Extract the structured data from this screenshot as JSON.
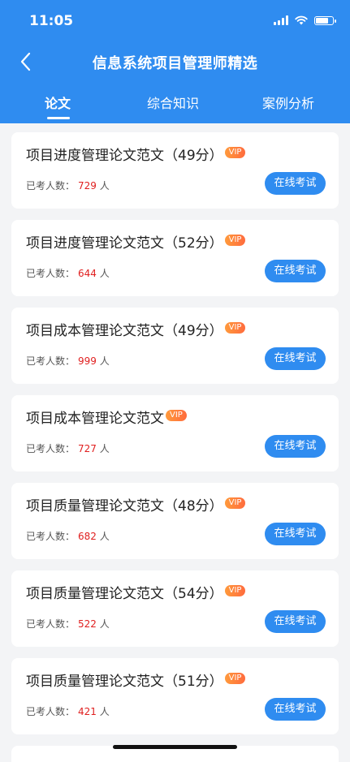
{
  "status_bar": {
    "time": "11:05"
  },
  "header": {
    "title": "信息系统项目管理师精选",
    "tabs": [
      {
        "label": "论文",
        "active": true
      },
      {
        "label": "综合知识",
        "active": false
      },
      {
        "label": "案例分析",
        "active": false
      }
    ]
  },
  "colors": {
    "accent": "#2f8cf0",
    "count_red": "#e02020",
    "vip_orange": "#ff7a3d"
  },
  "list": {
    "count_label": "已考人数：",
    "count_suffix": "人",
    "button_label": "在线考试",
    "vip_label": "VIP",
    "items": [
      {
        "title": "项目进度管理论文范文（49分）",
        "count": "729"
      },
      {
        "title": "项目进度管理论文范文（52分）",
        "count": "644"
      },
      {
        "title": "项目成本管理论文范文（49分）",
        "count": "999"
      },
      {
        "title": "项目成本管理论文范文",
        "count": "727"
      },
      {
        "title": "项目质量管理论文范文（48分）",
        "count": "682"
      },
      {
        "title": "项目质量管理论文范文（54分）",
        "count": "522"
      },
      {
        "title": "项目质量管理论文范文（51分）",
        "count": "421"
      }
    ]
  }
}
